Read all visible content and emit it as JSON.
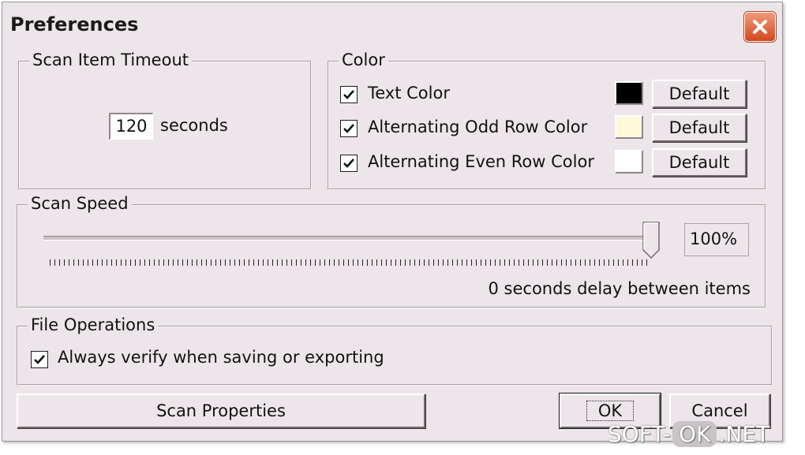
{
  "window": {
    "title": "Preferences"
  },
  "scan_item_timeout": {
    "label": "Scan Item Timeout",
    "value": "120",
    "unit": "seconds"
  },
  "color": {
    "label": "Color",
    "rows": [
      {
        "label": "Text Color",
        "checked": true,
        "swatch": "#000000",
        "button": "Default"
      },
      {
        "label": "Alternating Odd Row Color",
        "checked": true,
        "swatch": "#fdfadc",
        "button": "Default"
      },
      {
        "label": "Alternating Even Row Color",
        "checked": true,
        "swatch": "#ffffff",
        "button": "Default"
      }
    ]
  },
  "scan_speed": {
    "label": "Scan Speed",
    "value_text": "100%",
    "level": 1.0,
    "delay_text": "0 seconds delay between items"
  },
  "file_operations": {
    "label": "File Operations",
    "verify_label": "Always verify when saving or exporting",
    "verify_checked": true
  },
  "buttons": {
    "scan_properties": "Scan Properties",
    "ok": "OK",
    "cancel": "Cancel"
  },
  "watermark": {
    "left": "SOFT-",
    "middle": "OK",
    "right": ".NET"
  }
}
